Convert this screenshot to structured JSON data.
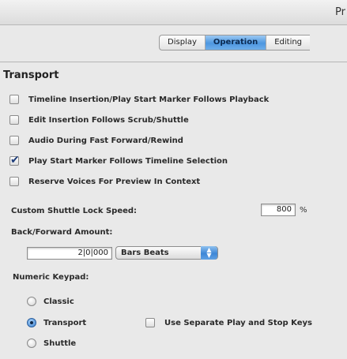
{
  "window": {
    "title": "Pr"
  },
  "tabs": [
    {
      "label": "Display",
      "active": false
    },
    {
      "label": "Operation",
      "active": true
    },
    {
      "label": "Editing",
      "active": false
    }
  ],
  "transport": {
    "heading": "Transport",
    "options": [
      {
        "label": "Timeline Insertion/Play Start Marker Follows Playback",
        "checked": false
      },
      {
        "label": "Edit Insertion Follows Scrub/Shuttle",
        "checked": false
      },
      {
        "label": "Audio During Fast Forward/Rewind",
        "checked": false
      },
      {
        "label": "Play Start Marker Follows Timeline Selection",
        "checked": true
      },
      {
        "label": "Reserve Voices For Preview In Context",
        "checked": false
      }
    ]
  },
  "shuttle": {
    "label": "Custom Shuttle Lock Speed:",
    "value": "800",
    "unit": "%"
  },
  "back_forward": {
    "label": "Back/Forward Amount:",
    "value": "2|0|000",
    "format": "Bars Beats"
  },
  "keypad": {
    "label": "Numeric Keypad:",
    "options": [
      {
        "label": "Classic",
        "selected": false
      },
      {
        "label": "Transport",
        "selected": true
      },
      {
        "label": "Shuttle",
        "selected": false
      }
    ],
    "separate_keys": {
      "label": "Use Separate Play and Stop Keys",
      "checked": false
    }
  },
  "colors": {
    "accent": "#4d97e0",
    "background": "#e9e9e9"
  }
}
